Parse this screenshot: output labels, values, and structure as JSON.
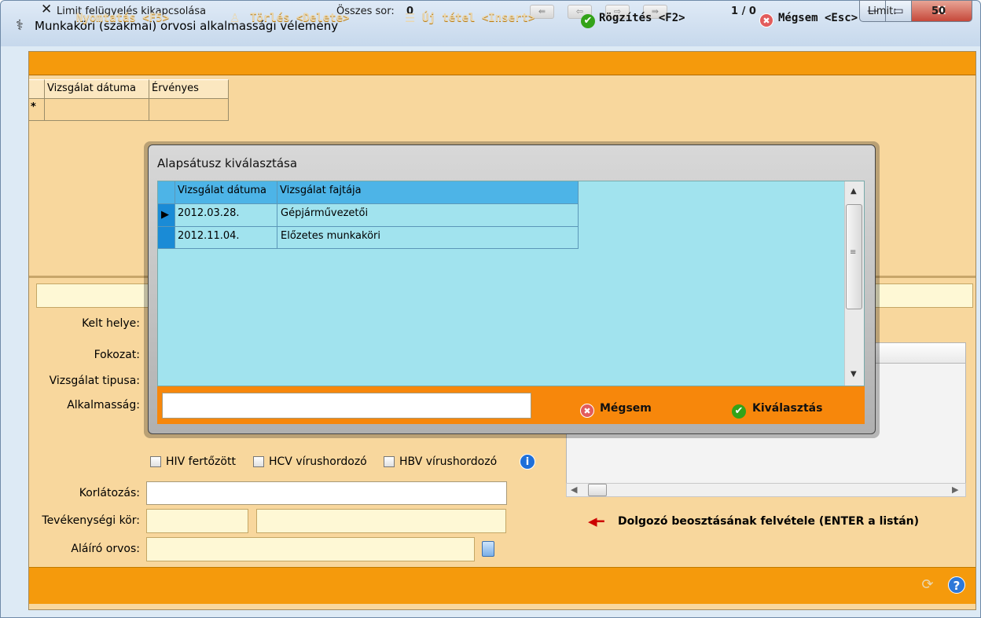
{
  "window": {
    "title": "Munkaköri (szakmai) orvosi alkalmassági vélemény",
    "minimize": "—",
    "maximize": "▭",
    "close": "X"
  },
  "limitbar": {
    "limit_toggle": "Limit felügyelés kikapcsolása",
    "total_rows_label": "Összes sor:",
    "total_rows_value": "0",
    "nav_first": "⇚",
    "nav_prev": "⇦",
    "nav_next": "⇨",
    "nav_last": "⇛",
    "page_indicator": "1 / 0",
    "limit_label": "Limit:",
    "limit_value": "50"
  },
  "upper_grid": {
    "columns": [
      "Vizsgálat dátuma",
      "Érvényes"
    ],
    "new_row_marker": "*"
  },
  "form": {
    "kelt_helye_label": "Kelt helye:",
    "fokozat_label": "Fokozat:",
    "vizsgalat_tipusa_label": "Vizsgálat tipusa:",
    "alkalmassag_label": "Alkalmasság:",
    "hiv_label": "HIV fertőzött",
    "hcv_label": "HCV vírushordozó",
    "hbv_label": "HBV vírushordozó",
    "info_icon": "i",
    "korlatozas_label": "Korlátozás:",
    "korlatozas_value": "",
    "tevekenysegi_kor_label": "Tevékenységi kör:",
    "alairo_orvos_label": "Aláíró orvos:"
  },
  "right_panel": {
    "hint": "Dolgozó beosztásának felvétele (ENTER a listán)"
  },
  "bottombar": {
    "print": "Nyomtatás <F5>",
    "delete": "Törlés <Delete>",
    "new_item": "Új tétel <Insert>",
    "save": "Rögzítés <F2>",
    "cancel": "Mégsem <Esc>"
  },
  "dialog": {
    "title": "Alapsátusz kiválasztása",
    "columns": [
      "Vizsgálat dátuma",
      "Vizsgálat fajtája"
    ],
    "rows": [
      {
        "date": "2012.03.28.",
        "type": "Gépjárművezetői"
      },
      {
        "date": "2012.11.04.",
        "type": "Előzetes munkaköri"
      }
    ],
    "search_value": "",
    "cancel": "Mégsem",
    "select": "Kiválasztás"
  },
  "colors": {
    "orange_bar": "#f59a0c",
    "form_background": "#f8d79d",
    "dialog_grid": "#a1e3ee",
    "dialog_header": "#4db4e7",
    "dialog_footer": "#f7870b"
  }
}
